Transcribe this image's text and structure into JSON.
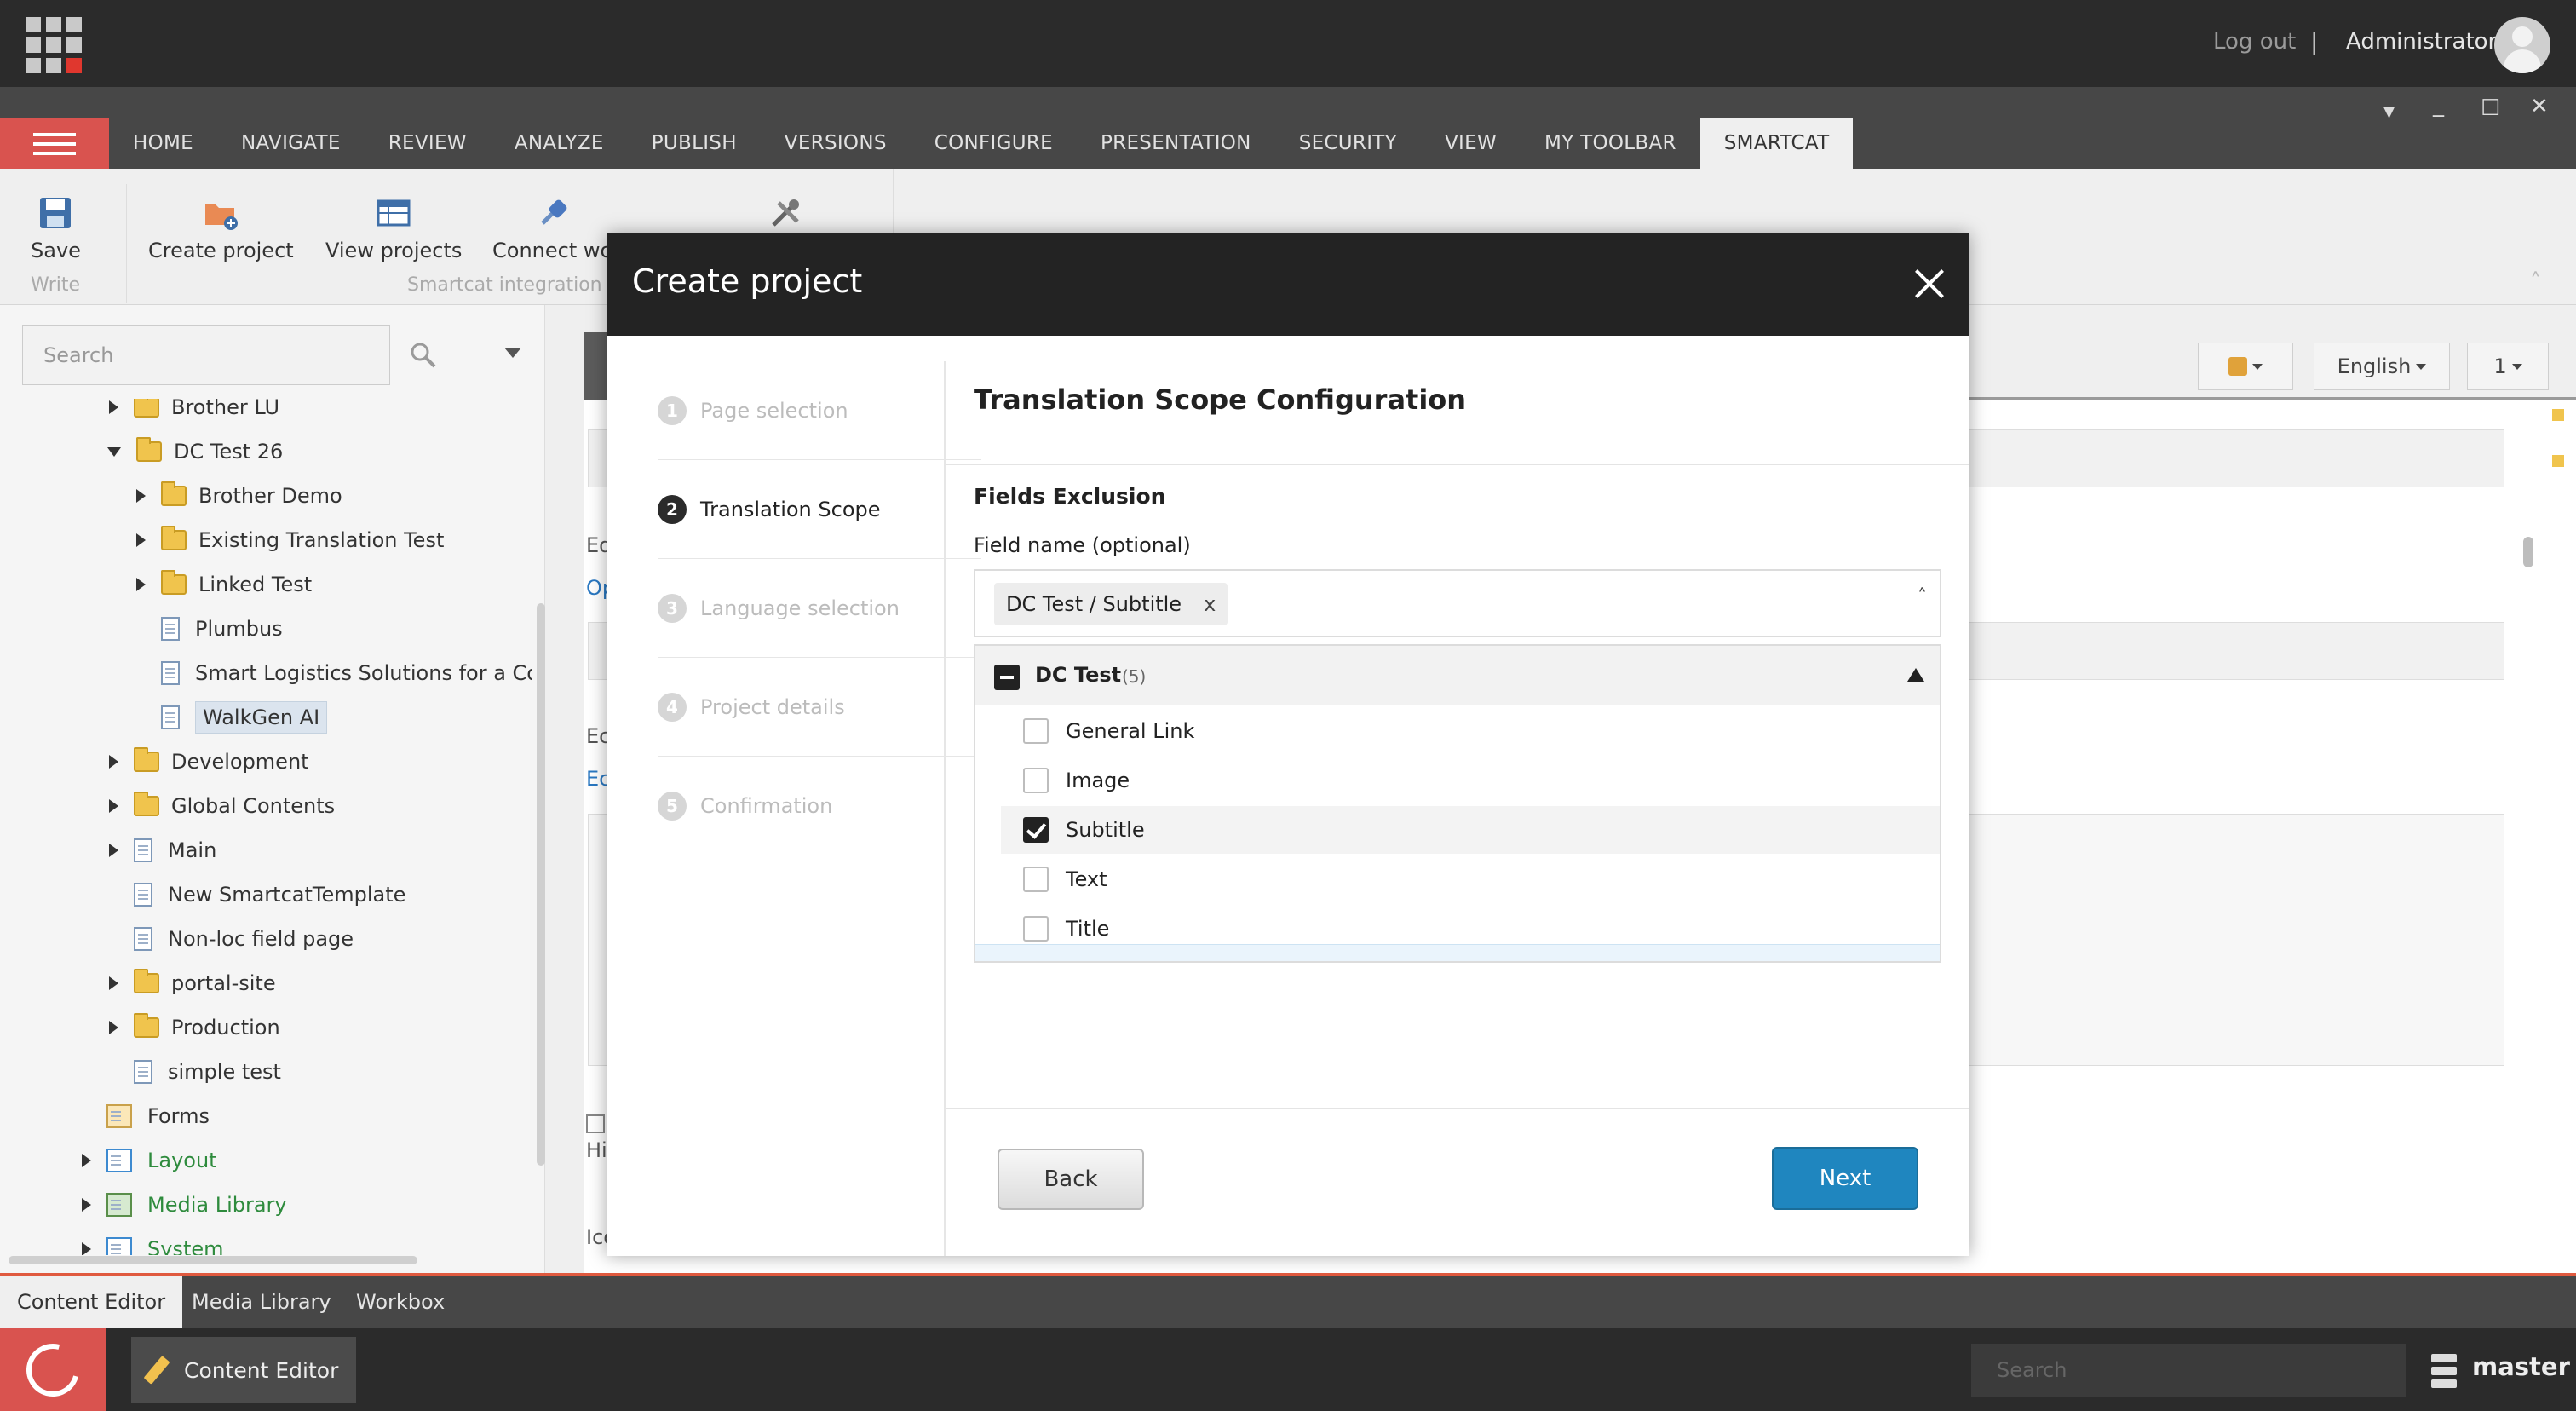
{
  "topbar": {
    "logout_label": "Log out",
    "separator": "|",
    "user_name": "Administrator"
  },
  "ribbon_tabs": [
    "HOME",
    "NAVIGATE",
    "REVIEW",
    "ANALYZE",
    "PUBLISH",
    "VERSIONS",
    "CONFIGURE",
    "PRESENTATION",
    "SECURITY",
    "VIEW",
    "MY TOOLBAR",
    "SMARTCAT"
  ],
  "active_ribbon_tab": "SMARTCAT",
  "ribbon": {
    "save_label": "Save",
    "write_group": "Write",
    "create_project_label": "Create project",
    "view_projects_label": "View projects",
    "connect_label": "Connect wo",
    "smartcat_group": "Smartcat integration"
  },
  "tree_search": {
    "placeholder": "Search"
  },
  "tree": {
    "items": [
      {
        "label": "Brother LU"
      },
      {
        "label": "DC Test 26"
      },
      {
        "label": "Brother Demo"
      },
      {
        "label": "Existing Translation Test"
      },
      {
        "label": "Linked Test"
      },
      {
        "label": "Plumbus"
      },
      {
        "label": "Smart Logistics Solutions for a Con"
      },
      {
        "label": "WalkGen AI"
      },
      {
        "label": "Development"
      },
      {
        "label": "Global Contents"
      },
      {
        "label": "Main"
      },
      {
        "label": "New SmartcatTemplate"
      },
      {
        "label": "Non-loc field page"
      },
      {
        "label": "portal-site"
      },
      {
        "label": "Production"
      },
      {
        "label": "simple test"
      },
      {
        "label": "Forms"
      },
      {
        "label": "Layout"
      },
      {
        "label": "Media Library"
      },
      {
        "label": "System"
      }
    ]
  },
  "content_controls": {
    "language": "English",
    "version": "1"
  },
  "background_fragments": {
    "a": "Ed",
    "b": "Op",
    "c": "Ec",
    "d": "Ec",
    "e": "Hi",
    "f": "Ico"
  },
  "modal": {
    "title": "Create project",
    "steps": [
      {
        "num": "1",
        "label": "Page selection"
      },
      {
        "num": "2",
        "label": "Translation Scope"
      },
      {
        "num": "3",
        "label": "Language selection"
      },
      {
        "num": "4",
        "label": "Project details"
      },
      {
        "num": "5",
        "label": "Confirmation"
      }
    ],
    "active_step": 2,
    "section_title": "Translation Scope Configuration",
    "fields_exclusion_label": "Fields Exclusion",
    "field_name_label": "Field name (optional)",
    "selected_chip": "DC Test / Subtitle",
    "chip_remove": "x",
    "select_caret": "˄",
    "group": {
      "name": "DC Test",
      "count": "(5)",
      "options": [
        {
          "label": "General Link",
          "checked": false
        },
        {
          "label": "Image",
          "checked": false
        },
        {
          "label": "Subtitle",
          "checked": true
        },
        {
          "label": "Text",
          "checked": false
        },
        {
          "label": "Title",
          "checked": false
        }
      ]
    },
    "back_label": "Back",
    "next_label": "Next"
  },
  "bottom_tabs": [
    "Content Editor",
    "Media Library",
    "Workbox"
  ],
  "taskbar": {
    "app_label": "Content Editor",
    "search_placeholder": "Search",
    "database": "master"
  },
  "colors": {
    "accent_red": "#d9534f",
    "primary_blue": "#1f86bf",
    "dark": "#2b2b2b"
  }
}
